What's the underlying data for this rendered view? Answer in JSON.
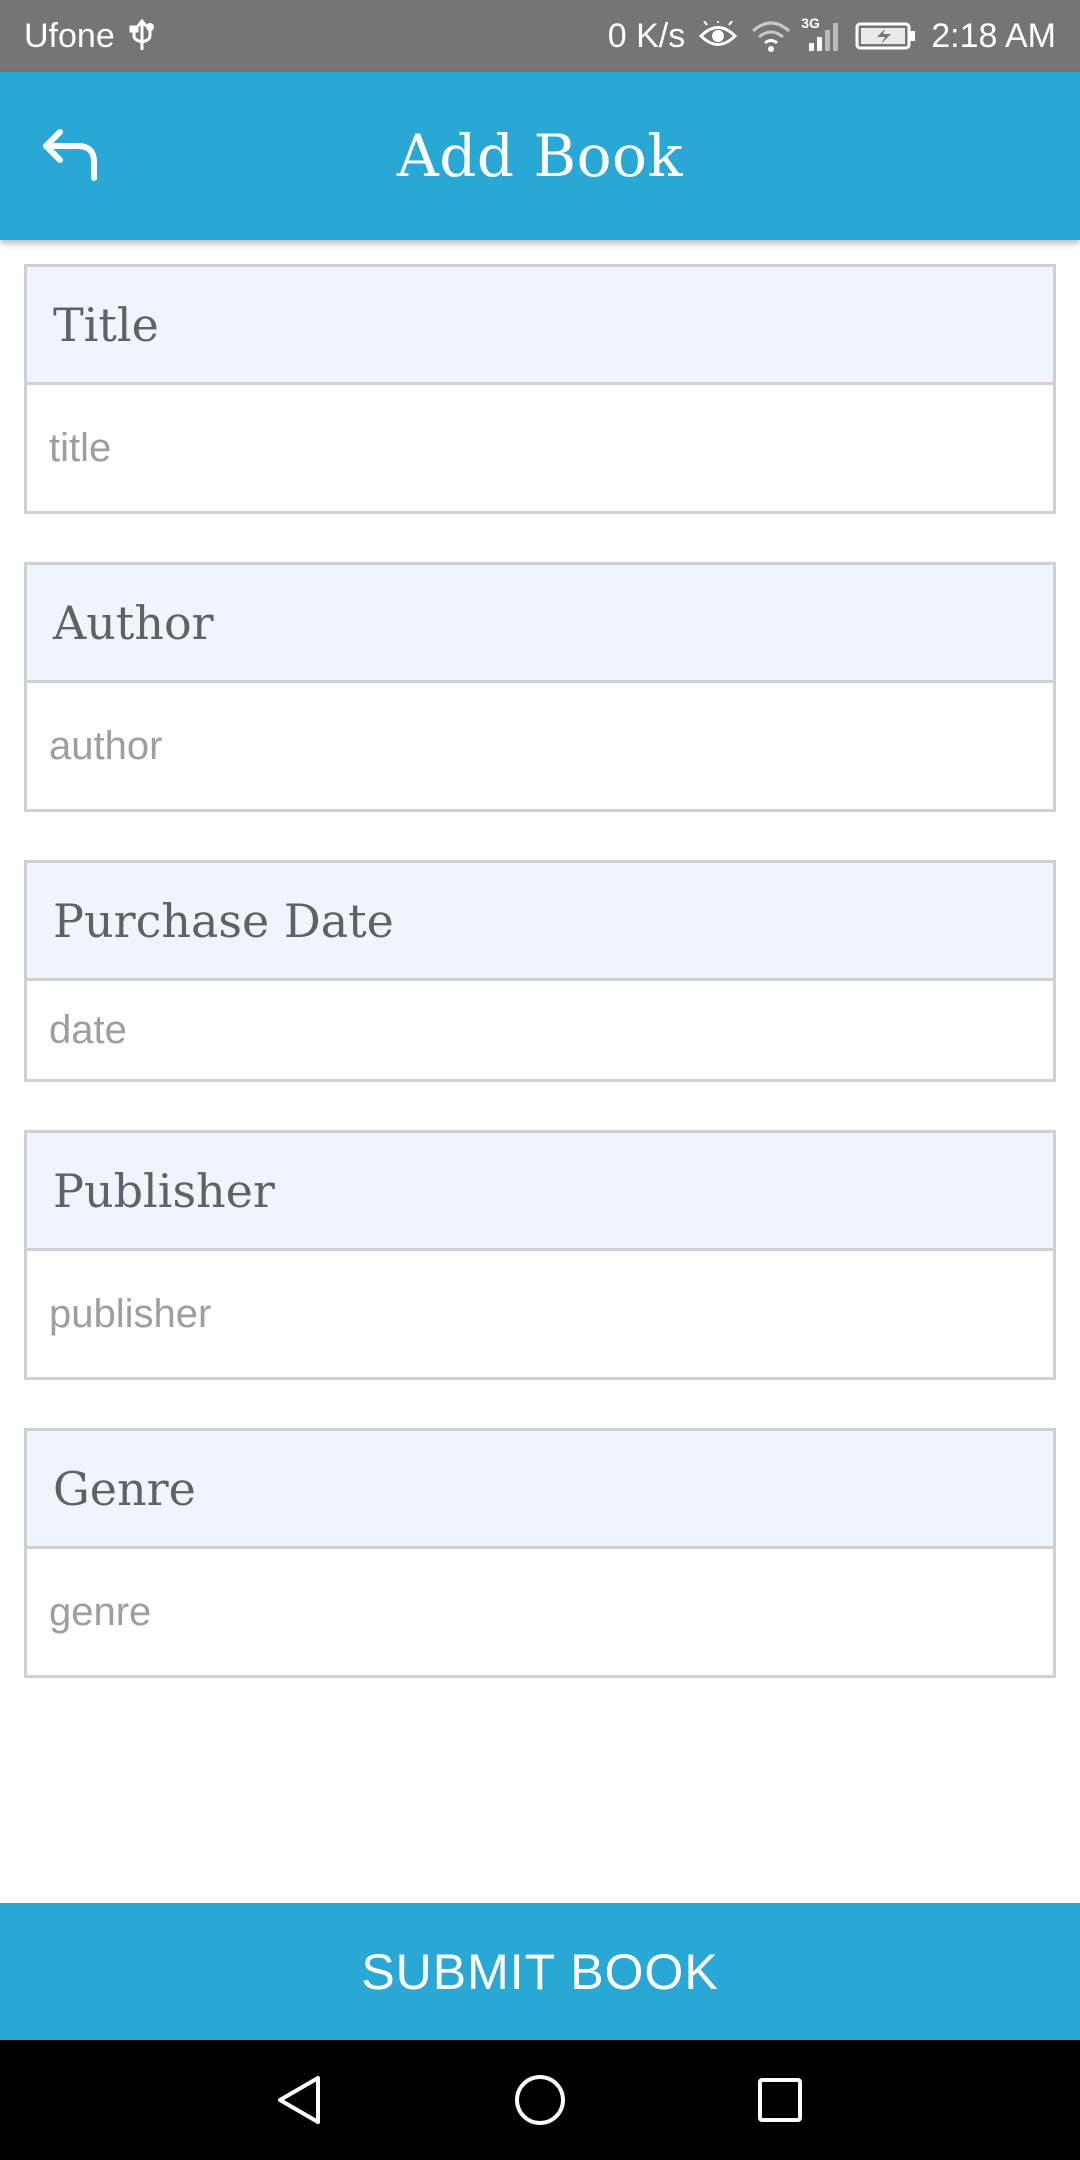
{
  "status_bar": {
    "carrier": "Ufone",
    "net_speed": "0 K/s",
    "network_type": "3G",
    "time": "2:18 AM",
    "icons": [
      "usb-icon",
      "eye-icon",
      "wifi-icon",
      "signal-icon",
      "battery-icon"
    ]
  },
  "app_bar": {
    "title": "Add Book",
    "back_icon": "back-arrow-icon",
    "color": "#29a8d6"
  },
  "form": {
    "fields": [
      {
        "label": "Title",
        "placeholder": "title",
        "value": ""
      },
      {
        "label": "Author",
        "placeholder": "author",
        "value": ""
      },
      {
        "label": "Purchase Date",
        "placeholder": "date",
        "value": ""
      },
      {
        "label": "Publisher",
        "placeholder": "publisher",
        "value": ""
      },
      {
        "label": "Genre",
        "placeholder": "genre",
        "value": ""
      }
    ]
  },
  "submit": {
    "label": "SUBMIT BOOK"
  },
  "nav_bar": {
    "icons": [
      "nav-back-icon",
      "nav-home-icon",
      "nav-recents-icon"
    ]
  }
}
